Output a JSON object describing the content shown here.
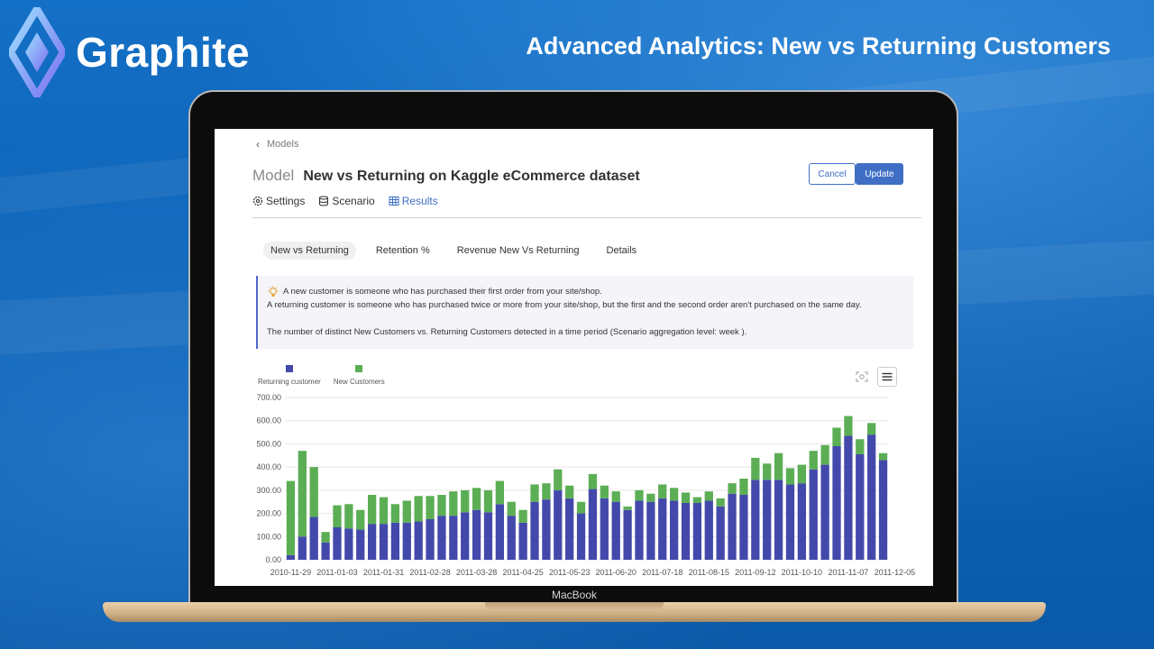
{
  "brand": {
    "name": "Graphite"
  },
  "headline": "Advanced Analytics: New vs Returning Customers",
  "laptop": {
    "label": "MacBook"
  },
  "app": {
    "breadcrumb": "Models",
    "title_prefix": "Model",
    "title": "New vs Returning on Kaggle eCommerce dataset",
    "buttons": {
      "cancel": "Cancel",
      "update": "Update"
    },
    "tabs": [
      {
        "label": "Settings",
        "icon": "gear-icon"
      },
      {
        "label": "Scenario",
        "icon": "database-icon"
      },
      {
        "label": "Results",
        "icon": "table-icon",
        "active": true
      }
    ],
    "subtabs": [
      {
        "label": "New vs Returning",
        "active": true
      },
      {
        "label": "Retention %"
      },
      {
        "label": "Revenue New Vs Returning"
      },
      {
        "label": "Details"
      }
    ],
    "info": {
      "line1": "A new customer is someone who has purchased their first order from your site/shop.",
      "line2": "A returning customer is someone who has purchased twice or more from your site/shop, but the first and the second order aren't purchased on the same day.",
      "line3": "The number of distinct New Customers vs. Returning Customers detected in a time period (Scenario aggregation level: week )."
    }
  },
  "colors": {
    "returning": "#4349ab",
    "new": "#5cae55",
    "accent": "#3f6fc4"
  },
  "chart_data": {
    "type": "bar",
    "stacked": true,
    "legend_position": "top-left",
    "grid": true,
    "ylim": [
      0,
      700
    ],
    "y_ticks": [
      "0.00",
      "100.00",
      "200.00",
      "300.00",
      "400.00",
      "500.00",
      "600.00",
      "700.00"
    ],
    "x_tick_labels": [
      "2010-11-29",
      "2011-01-03",
      "2011-01-31",
      "2011-02-28",
      "2011-03-28",
      "2011-04-25",
      "2011-05-23",
      "2011-06-20",
      "2011-07-18",
      "2011-08-15",
      "2011-09-12",
      "2011-10-10",
      "2011-11-07",
      "2011-12-05"
    ],
    "x_tick_every": 4,
    "series": [
      {
        "name": "Returning customer",
        "values": [
          20,
          100,
          185,
          75,
          140,
          135,
          130,
          155,
          155,
          160,
          160,
          165,
          175,
          190,
          190,
          205,
          215,
          205,
          240,
          190,
          160,
          250,
          260,
          300,
          265,
          200,
          305,
          265,
          250,
          215,
          255,
          250,
          265,
          255,
          245,
          245,
          255,
          230,
          285,
          280,
          345,
          345,
          345,
          325,
          330,
          390,
          410,
          490,
          535,
          455,
          540,
          430
        ]
      },
      {
        "name": "New Customers",
        "values": [
          320,
          370,
          215,
          45,
          95,
          105,
          85,
          125,
          115,
          80,
          95,
          110,
          100,
          90,
          105,
          95,
          95,
          95,
          100,
          60,
          55,
          75,
          70,
          90,
          55,
          50,
          65,
          55,
          45,
          15,
          45,
          35,
          60,
          55,
          45,
          25,
          40,
          35,
          45,
          70,
          95,
          70,
          115,
          70,
          80,
          80,
          85,
          80,
          85,
          65,
          50,
          30
        ]
      }
    ]
  }
}
